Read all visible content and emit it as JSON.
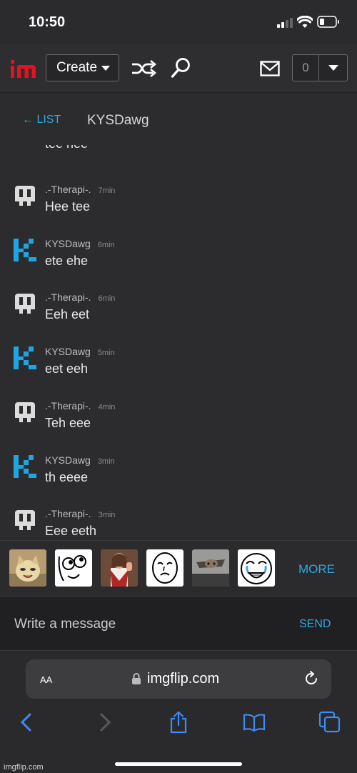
{
  "status_bar": {
    "time": "10:50"
  },
  "header": {
    "create_label": "Create",
    "notification_count": "0"
  },
  "conversation": {
    "back_label": "← LIST",
    "partner_name": "KYSDawg"
  },
  "messages": [
    {
      "user": "",
      "time": "",
      "text": "tee hee",
      "avatar": "kysdawg"
    },
    {
      "user": ".-Therapi-.",
      "time": "7min",
      "text": "Hee tee",
      "avatar": "therapi"
    },
    {
      "user": "KYSDawg",
      "time": "6min",
      "text": "ete ehe",
      "avatar": "kysdawg"
    },
    {
      "user": ".-Therapi-.",
      "time": "6min",
      "text": "Eeh eet",
      "avatar": "therapi"
    },
    {
      "user": "KYSDawg",
      "time": "5min",
      "text": "eet eeh",
      "avatar": "kysdawg"
    },
    {
      "user": ".-Therapi-.",
      "time": "4min",
      "text": "Teh eee",
      "avatar": "therapi"
    },
    {
      "user": "KYSDawg",
      "time": "3min",
      "text": "th eeee",
      "avatar": "kysdawg"
    },
    {
      "user": ".-Therapi-.",
      "time": "3min",
      "text": "Eee eeth",
      "avatar": "therapi"
    }
  ],
  "stickers": {
    "items": [
      "happy-cat-sticker",
      "derp-face-sticker",
      "buddy-christ-sticker",
      "okay-face-sticker",
      "ceiling-cat-sticker",
      "happy-cry-face-sticker"
    ],
    "more_label": "MORE"
  },
  "compose": {
    "placeholder": "Write a message",
    "send_label": "SEND"
  },
  "browser": {
    "aa_label": "AA",
    "domain": "imgflip.com"
  },
  "watermark": "imgflip.com",
  "colors": {
    "accent": "#2fa7e3",
    "logo_red": "#e0131f",
    "background": "#2c2c2e",
    "safari_blue": "#3d8bf5"
  }
}
